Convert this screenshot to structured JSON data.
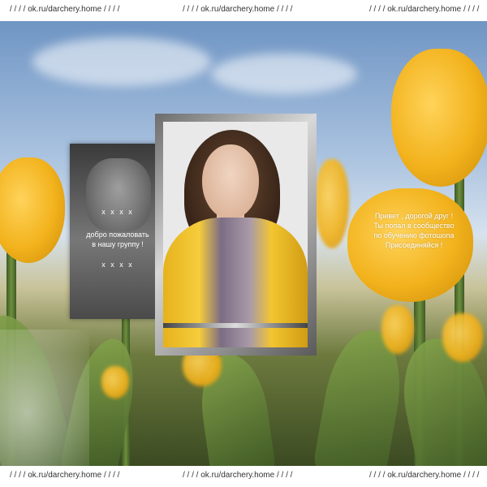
{
  "header": {
    "links": [
      "/ / / / ok.ru/darchery.home / / / /",
      "/ / / / ok.ru/darchery.home / / / /",
      "/ / / / ok.ru/darchery.home / / / /"
    ]
  },
  "footer": {
    "links": [
      "/ / / / ok.ru/darchery.home / / / /",
      "/ / / / ok.ru/darchery.home / / / /",
      "/ / / / ok.ru/darchery.home / / / /"
    ]
  },
  "left_card": {
    "marker_top": "x x x x",
    "line1": "добро пожаловать",
    "line2": "в нашу группу !",
    "marker_bottom": "x x x x"
  },
  "tulip_text": {
    "line1": "Привет , дорогой друг !",
    "line2": "Ты попал в сообщество",
    "line3": "по обучению фотошопа",
    "line4": "Присоединяйся !"
  },
  "colors": {
    "tulip": "#f2b21c",
    "sky": "#a9c2df",
    "card_dark": "#3a3a3a",
    "card_frame": "#9a9a9a"
  }
}
